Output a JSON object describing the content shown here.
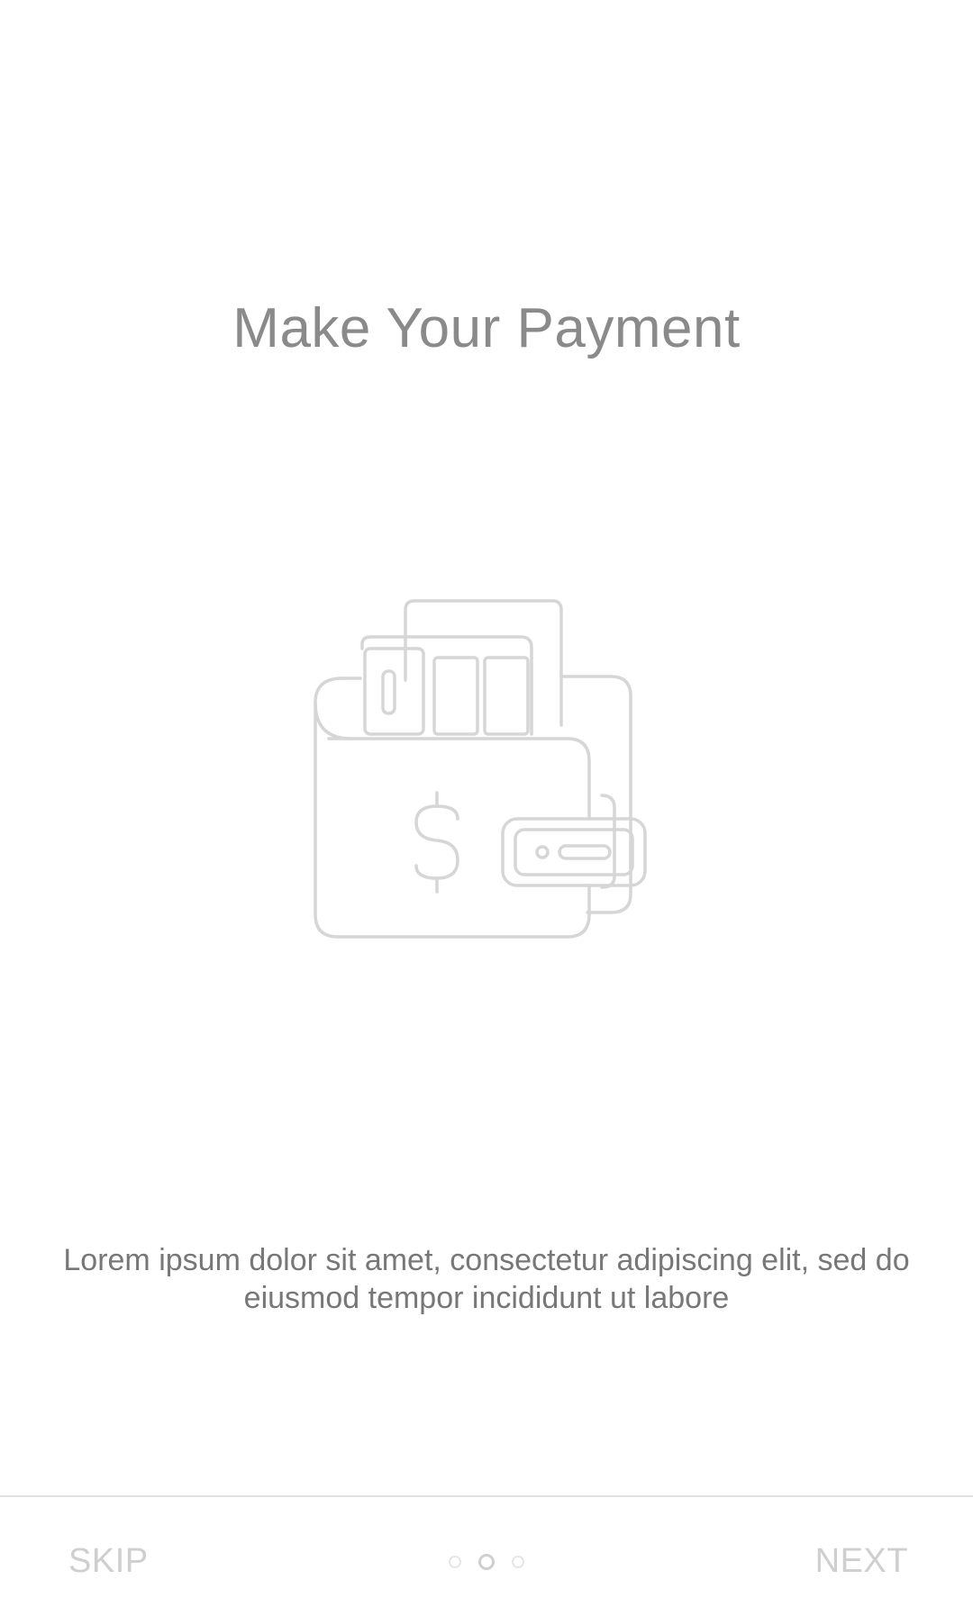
{
  "onboarding": {
    "title": "Make Your Payment",
    "illustration_icon": "wallet-icon",
    "description": "Lorem ipsum dolor sit amet, consectetur adipiscing elit, sed do eiusmod tempor incididunt ut labore"
  },
  "footer": {
    "skip_label": "SKIP",
    "next_label": "NEXT",
    "pager": {
      "total_pages": 3,
      "active_page": 2
    }
  },
  "colors": {
    "title": "#8a8a8a",
    "text": "#777777",
    "muted": "#cfcfcf",
    "divider": "#e2e2e2",
    "icon_stroke": "#d6d6d6"
  }
}
